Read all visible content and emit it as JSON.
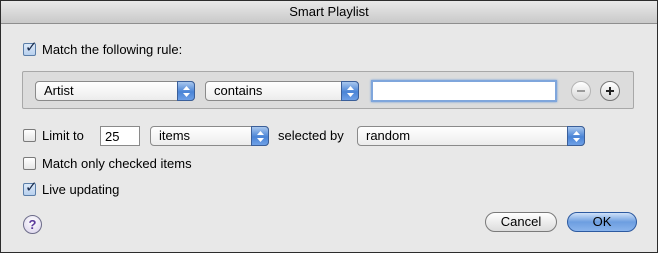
{
  "window": {
    "title": "Smart Playlist"
  },
  "match_rule": {
    "checked": true,
    "label": "Match the following rule:"
  },
  "rule": {
    "field": "Artist",
    "operator": "contains",
    "value": ""
  },
  "limit": {
    "checked": false,
    "label": "Limit to",
    "count": "25",
    "unit": "items",
    "selected_by_label": "selected by",
    "selected_by": "random"
  },
  "match_only_checked": {
    "checked": false,
    "label": "Match only checked items"
  },
  "live_updating": {
    "checked": true,
    "label": "Live updating"
  },
  "buttons": {
    "help": "?",
    "cancel": "Cancel",
    "ok": "OK"
  },
  "icons": {
    "remove": "minus-circle-icon",
    "add": "plus-circle-icon",
    "popup": "updown-arrows-icon"
  },
  "colors": {
    "accent": "#4a84d6",
    "help": "#5b3a9c"
  }
}
